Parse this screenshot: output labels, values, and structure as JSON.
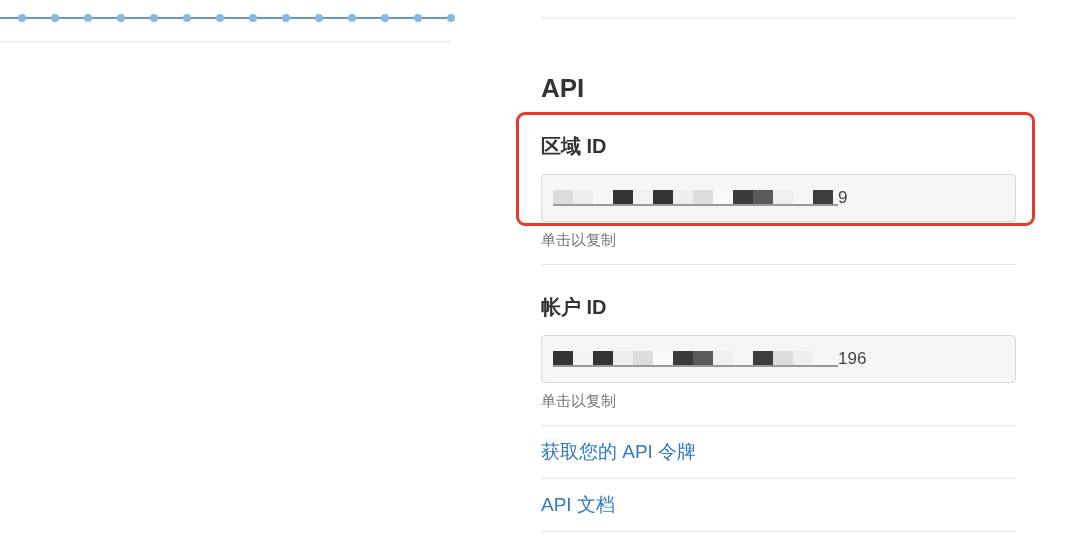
{
  "api_section": {
    "heading": "API",
    "fields": [
      {
        "label": "区域 ID",
        "value_tail": "9",
        "hint": "单击以复制",
        "highlighted": true
      },
      {
        "label": "帐户 ID",
        "value_tail": "196",
        "hint": "单击以复制",
        "highlighted": false
      }
    ],
    "links": [
      "获取您的 API 令牌",
      "API 文档"
    ]
  }
}
